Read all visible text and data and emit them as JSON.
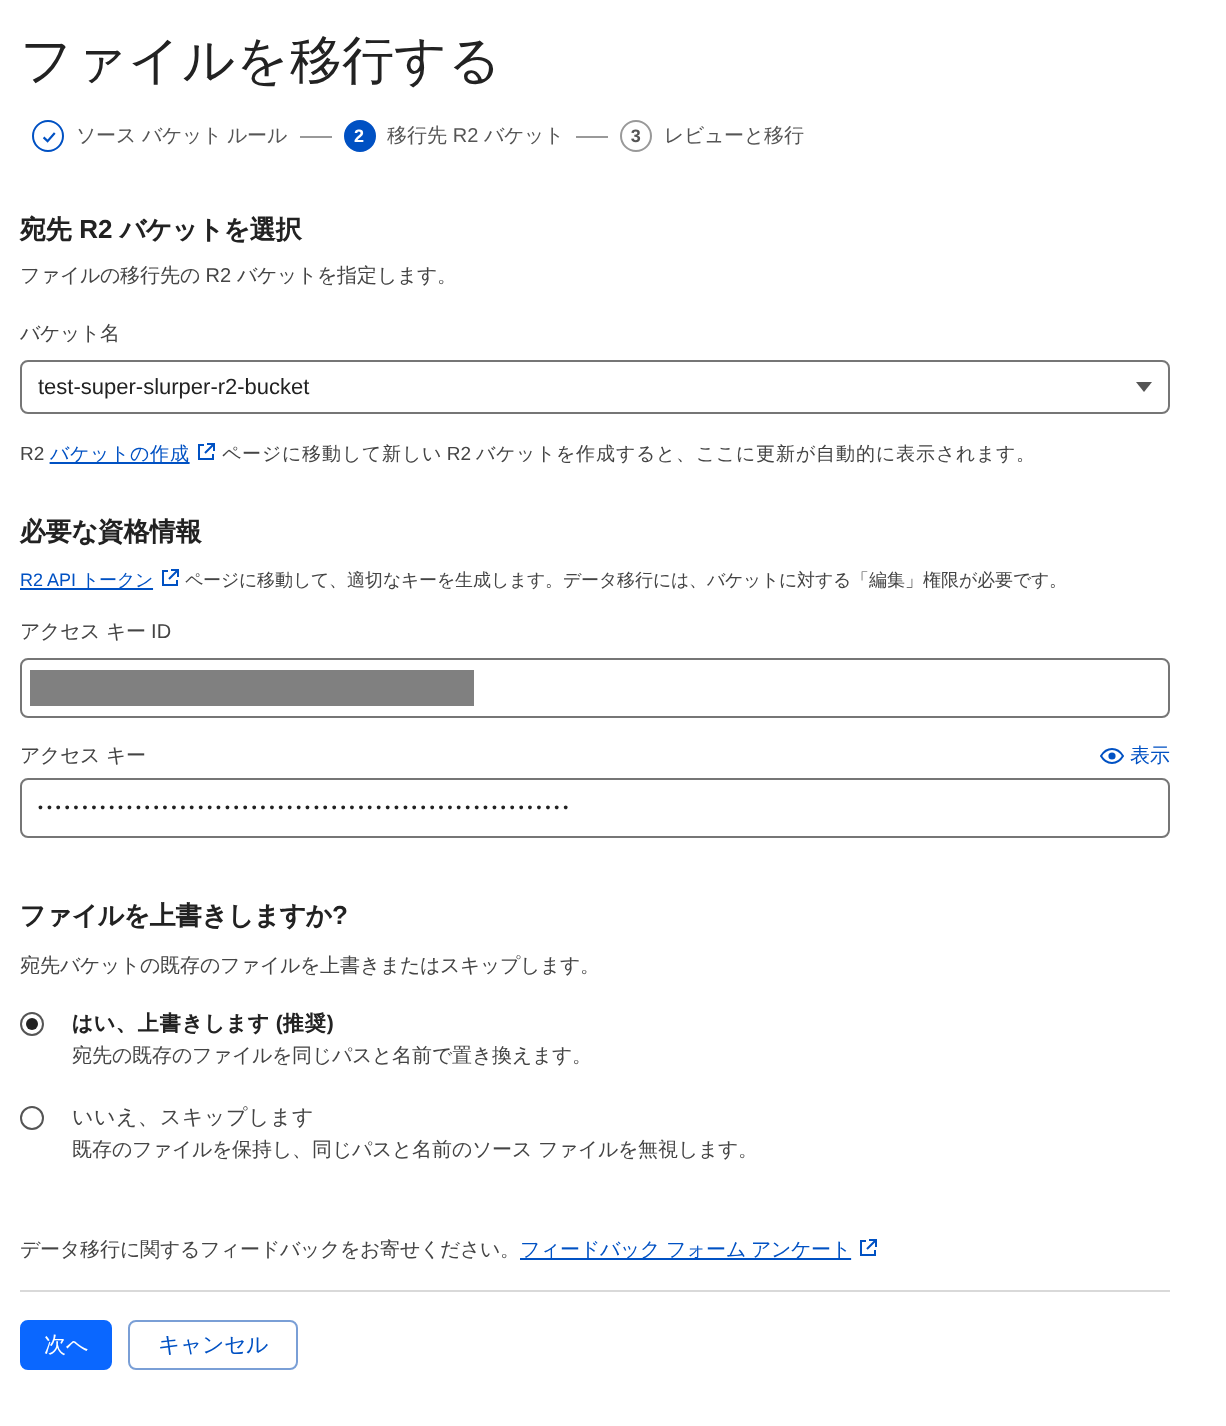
{
  "title": "ファイルを移行する",
  "steps": [
    {
      "label": "ソース バケット ルール",
      "completed": true,
      "selected": false
    },
    {
      "number": "2",
      "label": "移行先 R2 バケット",
      "completed": false,
      "selected": true
    },
    {
      "number": "3",
      "label": "レビューと移行",
      "completed": false,
      "selected": false
    }
  ],
  "destination": {
    "heading": "宛先 R2 バケットを選択",
    "description": "ファイルの移行先の R2 バケットを指定します。",
    "bucket_field": {
      "label": "バケット名",
      "value": "test-super-slurper-r2-bucket"
    },
    "hint": {
      "prefix": "R2",
      "link": "バケットの作成",
      "suffix": "ページに移動して新しい R2 バケットを作成すると、ここに更新が自動的に表示されます。"
    }
  },
  "credentials": {
    "heading": "必要な資格情報",
    "hint": {
      "link": "R2 API トークン",
      "suffix": "ページに移動して、適切なキーを生成します。データ移行には、バケットに対する「編集」権限が必要です。"
    },
    "access_key_id": {
      "label": "アクセス キー ID",
      "redacted": true
    },
    "access_key": {
      "label": "アクセス キー",
      "show_label": "表示",
      "value": "••••••••••••••••••••••••••••••••••••••••••••••••••••••••••••"
    }
  },
  "overwrite": {
    "heading": "ファイルを上書きしますか?",
    "description": "宛先バケットの既存のファイルを上書きまたはスキップします。",
    "options": [
      {
        "label": "はい、上書きします (推奨)",
        "description": "宛先の既存のファイルを同じパスと名前で置き換えます。",
        "selected": true
      },
      {
        "label": "いいえ、スキップします",
        "description": "既存のファイルを保持し、同じパスと名前のソース ファイルを無視します。",
        "selected": false
      }
    ]
  },
  "feedback": {
    "text": "データ移行に関するフィードバックをお寄せください。",
    "link": "フィードバック フォーム アンケート"
  },
  "buttons": [
    {
      "label": "次へ",
      "kind": "primary"
    },
    {
      "label": "キャンセル",
      "kind": "secondary"
    }
  ]
}
